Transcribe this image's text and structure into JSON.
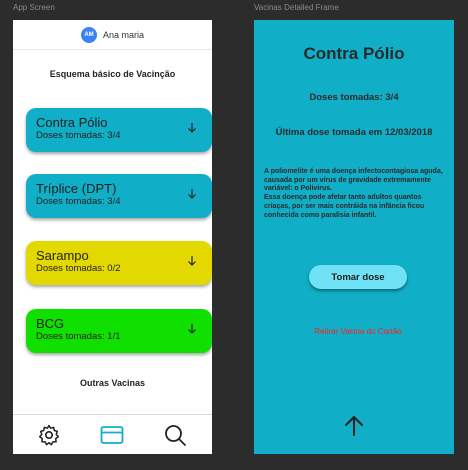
{
  "frames": {
    "app_label": "App Screen",
    "detail_label": "Vacinas Detailed Frame"
  },
  "header": {
    "avatar_initials": "AM",
    "user_name": "Ana maria"
  },
  "basic_section_title": "Esquema básico de Vacinção",
  "vaccines": [
    {
      "name": "Contra Pólio",
      "doses": "Doses tomadas: 3/4",
      "color": "#11aec7"
    },
    {
      "name": "Tríplice (DPT)",
      "doses": "Doses tomadas: 3/4",
      "color": "#11aec7"
    },
    {
      "name": "Sarampo",
      "doses": "Doses tomadas: 0/2",
      "color": "#e3d800"
    },
    {
      "name": "BCG",
      "doses": "Doses tomadas: 1/1",
      "color": "#0fe000"
    }
  ],
  "other_section_title": "Outras Vacinas",
  "bottom_nav": [
    "gear-icon",
    "card-icon",
    "search-icon"
  ],
  "accent_color": "#11aec7",
  "detail": {
    "title": "Contra Pólio",
    "doses": "Doses tomadas: 3/4",
    "last_dose": "Última dose tomada em 12/03/2018",
    "description_1": "A poliomelite é uma doença infectocontagiosa aguda, causada por um vírus de gravidade extremamente variável: o Polivirus.",
    "description_2": "Essa doença pode afetar tanto adultos quantos criaças, por ser mais contráida na infância ficou conhecida como paralisia infantil.",
    "take_button": "Tomar dose",
    "remove_link": "Retirar Vacina do Cartão"
  }
}
